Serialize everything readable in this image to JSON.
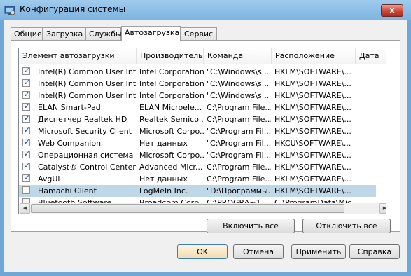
{
  "window": {
    "title": "Конфигурация системы",
    "close_glyph": "x"
  },
  "tabs": [
    {
      "label": "Общие"
    },
    {
      "label": "Загрузка"
    },
    {
      "label": "Службы"
    },
    {
      "label": "Автозагрузка"
    },
    {
      "label": "Сервис"
    }
  ],
  "active_tab": "Автозагрузка",
  "columns": [
    {
      "label": "Элемент автозагрузки"
    },
    {
      "label": "Производитель"
    },
    {
      "label": "Команда"
    },
    {
      "label": "Расположение"
    },
    {
      "label": "Дата"
    }
  ],
  "rows": [
    {
      "checked": true,
      "item": "Intel(R) Common User Interf...",
      "manufacturer": "Intel Corporation",
      "command": "\"C:\\Windows\\s...",
      "location": "HKLM\\SOFTWARE\\..."
    },
    {
      "checked": true,
      "item": "Intel(R) Common User Interf...",
      "manufacturer": "Intel Corporation",
      "command": "\"C:\\Windows\\s...",
      "location": "HKLM\\SOFTWARE\\..."
    },
    {
      "checked": true,
      "item": "Intel(R) Common User Interf...",
      "manufacturer": "Intel Corporation",
      "command": "\"C:\\Windows\\s...",
      "location": "HKLM\\SOFTWARE\\..."
    },
    {
      "checked": true,
      "item": "ELAN Smart-Pad",
      "manufacturer": "ELAN Microele...",
      "command": "C:\\Program File...",
      "location": "HKLM\\SOFTWARE\\..."
    },
    {
      "checked": true,
      "item": "Диспетчер Realtek HD",
      "manufacturer": "Realtek Semico...",
      "command": "C:\\Program File...",
      "location": "HKLM\\SOFTWARE\\..."
    },
    {
      "checked": true,
      "item": "Microsoft Security Client",
      "manufacturer": "Microsoft Corpo...",
      "command": "\"C:\\Program Fil...",
      "location": "HKLM\\SOFTWARE\\..."
    },
    {
      "checked": true,
      "item": "Web Companion",
      "manufacturer": "Нет данных",
      "command": "\"C:\\Program Fil...",
      "location": "HKCU\\SOFTWARE\\..."
    },
    {
      "checked": true,
      "item": "Операционная система М...",
      "manufacturer": "Microsoft Corpo...",
      "command": "\"C:\\Program Fil...",
      "location": "HKLM\\SOFTWARE\\..."
    },
    {
      "checked": true,
      "item": "Catalyst® Control Center",
      "manufacturer": "Advanced Micr...",
      "command": "C:\\Program File...",
      "location": "HKLM\\SOFTWARE\\..."
    },
    {
      "checked": true,
      "item": "AvgUi",
      "manufacturer": "Нет данных",
      "command": "C:\\Program File...",
      "location": "HKLM\\SOFTWARE\\..."
    },
    {
      "checked": false,
      "item": "Hamachi Client",
      "manufacturer": "LogMeIn Inc.",
      "command": "\"D:\\Программы...",
      "location": "HKLM\\SOFTWARE\\...",
      "selected": true
    },
    {
      "checked": false,
      "item": "Bluetooth Software",
      "manufacturer": "Broadcom Corp...",
      "command": "C:\\PROGRA~1...",
      "location": "C:\\ProgramData\\Mic..."
    }
  ],
  "actions": {
    "enable_all": "Включить все",
    "disable_all": "Отключить все"
  },
  "footer": {
    "ok": "OK",
    "cancel": "Отмена",
    "apply": "Применить",
    "help": "Справка"
  },
  "scroll": {
    "up_glyph": "▲",
    "down_glyph": "▼",
    "left_glyph": "◀",
    "right_glyph": "▶",
    "check_glyph": "✓"
  }
}
